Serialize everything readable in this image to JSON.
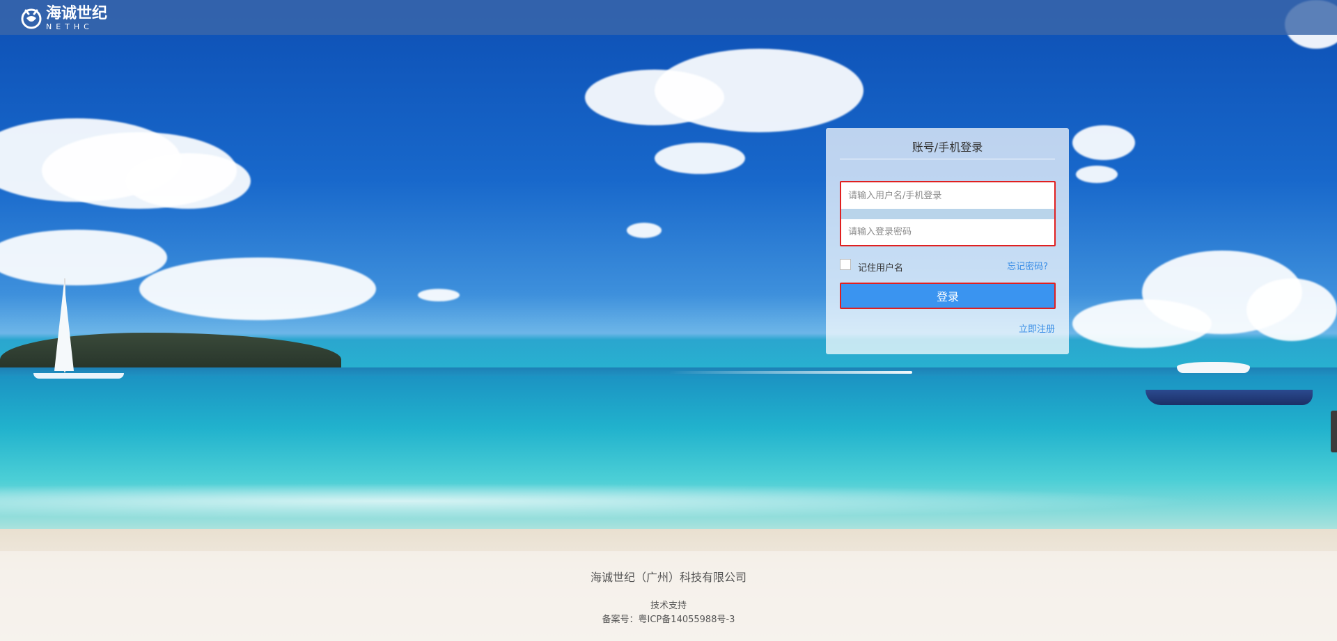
{
  "header": {
    "logo_cn": "海诚世纪",
    "logo_en": "NETHC",
    "logo_icon": "robot-head-icon"
  },
  "login": {
    "title": "账号/手机登录",
    "username_placeholder": "请输入用户名/手机登录",
    "username_value": "",
    "password_placeholder": "请输入登录密码",
    "password_value": "",
    "remember_label": "记住用户名",
    "remember_checked": false,
    "forgot_label": "忘记密码?",
    "login_label": "登录",
    "register_label": "立即注册"
  },
  "footer": {
    "company": "海诚世纪（广州）科技有限公司",
    "support": "技术支持",
    "icp": "备案号：粤ICP备14055988号-3"
  },
  "colors": {
    "header_bg": "#3a66aa",
    "button_bg": "#3a94f0",
    "highlight_border": "#e02020",
    "link": "#3a8ee6"
  }
}
